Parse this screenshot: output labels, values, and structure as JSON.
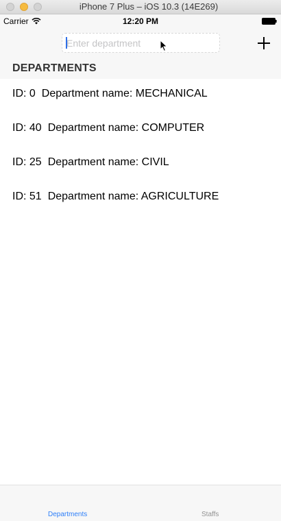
{
  "window": {
    "title": "iPhone 7 Plus – iOS 10.3 (14E269)"
  },
  "statusbar": {
    "carrier": "Carrier",
    "time": "12:20 PM",
    "wifi_icon": "wifi-icon",
    "battery_icon": "battery-icon"
  },
  "navbar": {
    "search_placeholder": "Enter department",
    "search_value": "",
    "add_icon": "plus-icon"
  },
  "section": {
    "header": "DEPARTMENTS"
  },
  "departments": [
    {
      "id_text": "ID: 0",
      "name_text": "Department name: MECHANICAL"
    },
    {
      "id_text": "ID: 40",
      "name_text": "Department name: COMPUTER"
    },
    {
      "id_text": "ID: 25",
      "name_text": "Department name: CIVIL"
    },
    {
      "id_text": "ID: 51",
      "name_text": "Department name: AGRICULTURE"
    }
  ],
  "tabs": [
    {
      "label": "Departments",
      "selected": true
    },
    {
      "label": "Staffs",
      "selected": false
    }
  ],
  "colors": {
    "accent": "#2d7ff9",
    "inactive_tab": "#929292",
    "bar_background": "#f7f7f7"
  }
}
